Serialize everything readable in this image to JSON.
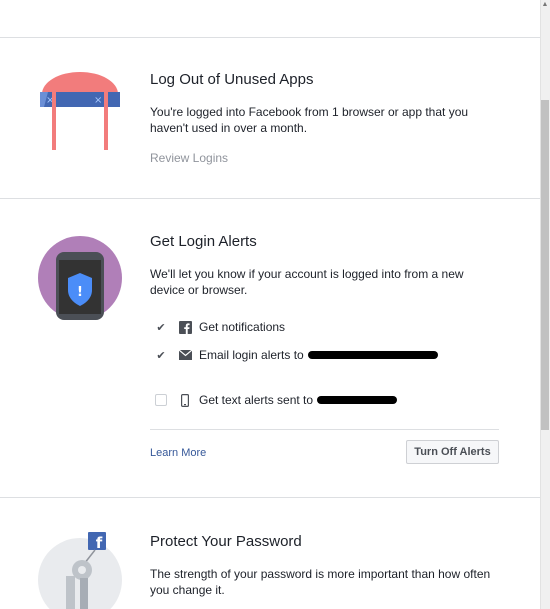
{
  "sections": {
    "logout": {
      "title": "Log Out of Unused Apps",
      "description": "You're logged into Facebook from 1 browser or app that you haven't used in over a month.",
      "link": "Review Logins"
    },
    "alerts": {
      "title": "Get Login Alerts",
      "description": "We'll let you know if your account is logged into from a new device or browser.",
      "options": [
        {
          "label": "Get notifications",
          "checked": true,
          "icon": "facebook-icon"
        },
        {
          "label": "Email login alerts to",
          "checked": true,
          "icon": "envelope-icon"
        },
        {
          "label": "Get text alerts sent to",
          "checked": false,
          "icon": "phone-icon"
        }
      ],
      "learn_more": "Learn More",
      "turn_off_button": "Turn Off Alerts"
    },
    "password": {
      "title": "Protect Your Password",
      "description": "The strength of your password is more important than how often you change it."
    }
  },
  "colors": {
    "link": "#365899",
    "muted": "#90949c",
    "accent_blue": "#4267b2",
    "salmon": "#f27c7c",
    "purple": "#b07fb8"
  }
}
